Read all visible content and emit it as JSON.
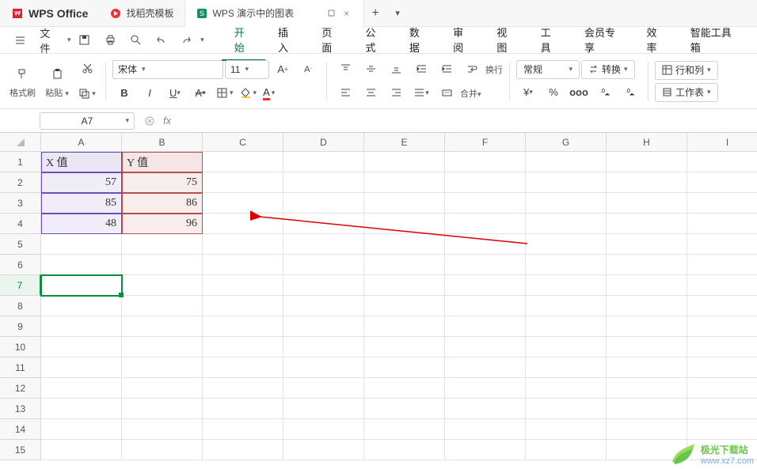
{
  "titlebar": {
    "app_name": "WPS Office",
    "tabs": [
      {
        "label": "找稻壳模板"
      },
      {
        "label": "WPS 演示中的图表"
      }
    ]
  },
  "menu": {
    "file": "文件",
    "items": [
      "开始",
      "插入",
      "页面",
      "公式",
      "数据",
      "审阅",
      "视图",
      "工具",
      "会员专享",
      "效率",
      "智能工具箱"
    ],
    "active": "开始"
  },
  "ribbon": {
    "format_painter": "格式刷",
    "paste": "粘贴",
    "font": "宋体",
    "fontsize": "11",
    "wrap": "换行",
    "merge": "合并",
    "numfmt": "常规",
    "convert": "转换",
    "rowcol": "行和列",
    "sheet": "工作表"
  },
  "fbar": {
    "namebox": "A7",
    "fx": "fx"
  },
  "grid": {
    "cols": [
      "A",
      "B",
      "C",
      "D",
      "E",
      "F",
      "G",
      "H",
      "I"
    ],
    "rows": [
      "1",
      "2",
      "3",
      "4",
      "5",
      "6",
      "7",
      "8",
      "9",
      "10",
      "11",
      "12",
      "13",
      "14",
      "15"
    ],
    "data": {
      "A1": "X 值",
      "B1": "Y 值",
      "A2": "57",
      "B2": "75",
      "A3": "85",
      "B3": "86",
      "A4": "48",
      "B4": "96"
    }
  },
  "chart_data": {
    "type": "table",
    "columns": [
      "X 值",
      "Y 值"
    ],
    "rows": [
      [
        57,
        75
      ],
      [
        85,
        86
      ],
      [
        48,
        96
      ]
    ]
  },
  "watermark": {
    "brand": "极光下载站",
    "url": "www.xz7.com"
  }
}
